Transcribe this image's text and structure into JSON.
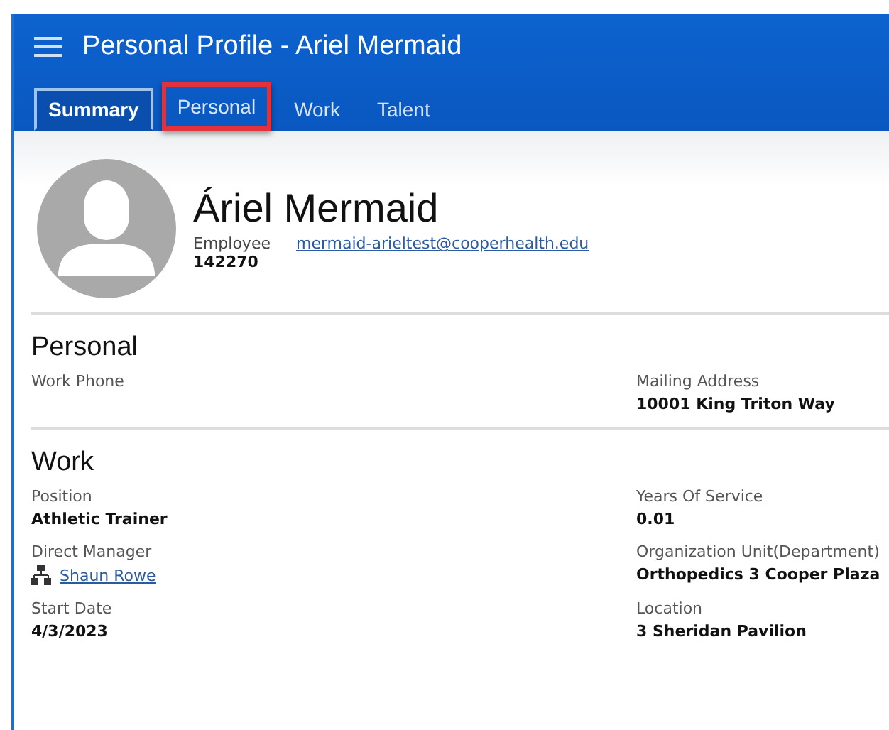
{
  "window": {
    "title": "Personal Profile - Ariel Mermaid"
  },
  "tabs": [
    {
      "label": "Summary",
      "selected": true,
      "highlighted": false
    },
    {
      "label": "Personal",
      "selected": false,
      "highlighted": true
    },
    {
      "label": "Work",
      "selected": false,
      "highlighted": false
    },
    {
      "label": "Talent",
      "selected": false,
      "highlighted": false
    }
  ],
  "profile": {
    "name": "Áriel Mermaid",
    "role": "Employee",
    "id": "142270",
    "email": "mermaid-arieltest@cooperhealth.edu"
  },
  "sections": [
    {
      "title": "Personal",
      "fields": [
        {
          "label": "Work Phone",
          "kind": "text"
        },
        {
          "label": "Mailing Address",
          "value": "10001 King Triton Way",
          "kind": "text"
        }
      ]
    },
    {
      "title": "Work",
      "fields": [
        {
          "label": "Position",
          "value": "Athletic Trainer",
          "kind": "text"
        },
        {
          "label": "Years Of Service",
          "value": "0.01",
          "kind": "text"
        },
        {
          "label": "Direct Manager",
          "value": "Shaun Rowe",
          "kind": "link"
        },
        {
          "label": "Organization Unit(Department)",
          "value": "Orthopedics 3 Cooper Plaza",
          "kind": "text"
        },
        {
          "label": "Start Date",
          "value": "4/3/2023",
          "kind": "text"
        },
        {
          "label": "Location",
          "value": "3 Sheridan Pavilion",
          "kind": "text"
        }
      ]
    }
  ]
}
